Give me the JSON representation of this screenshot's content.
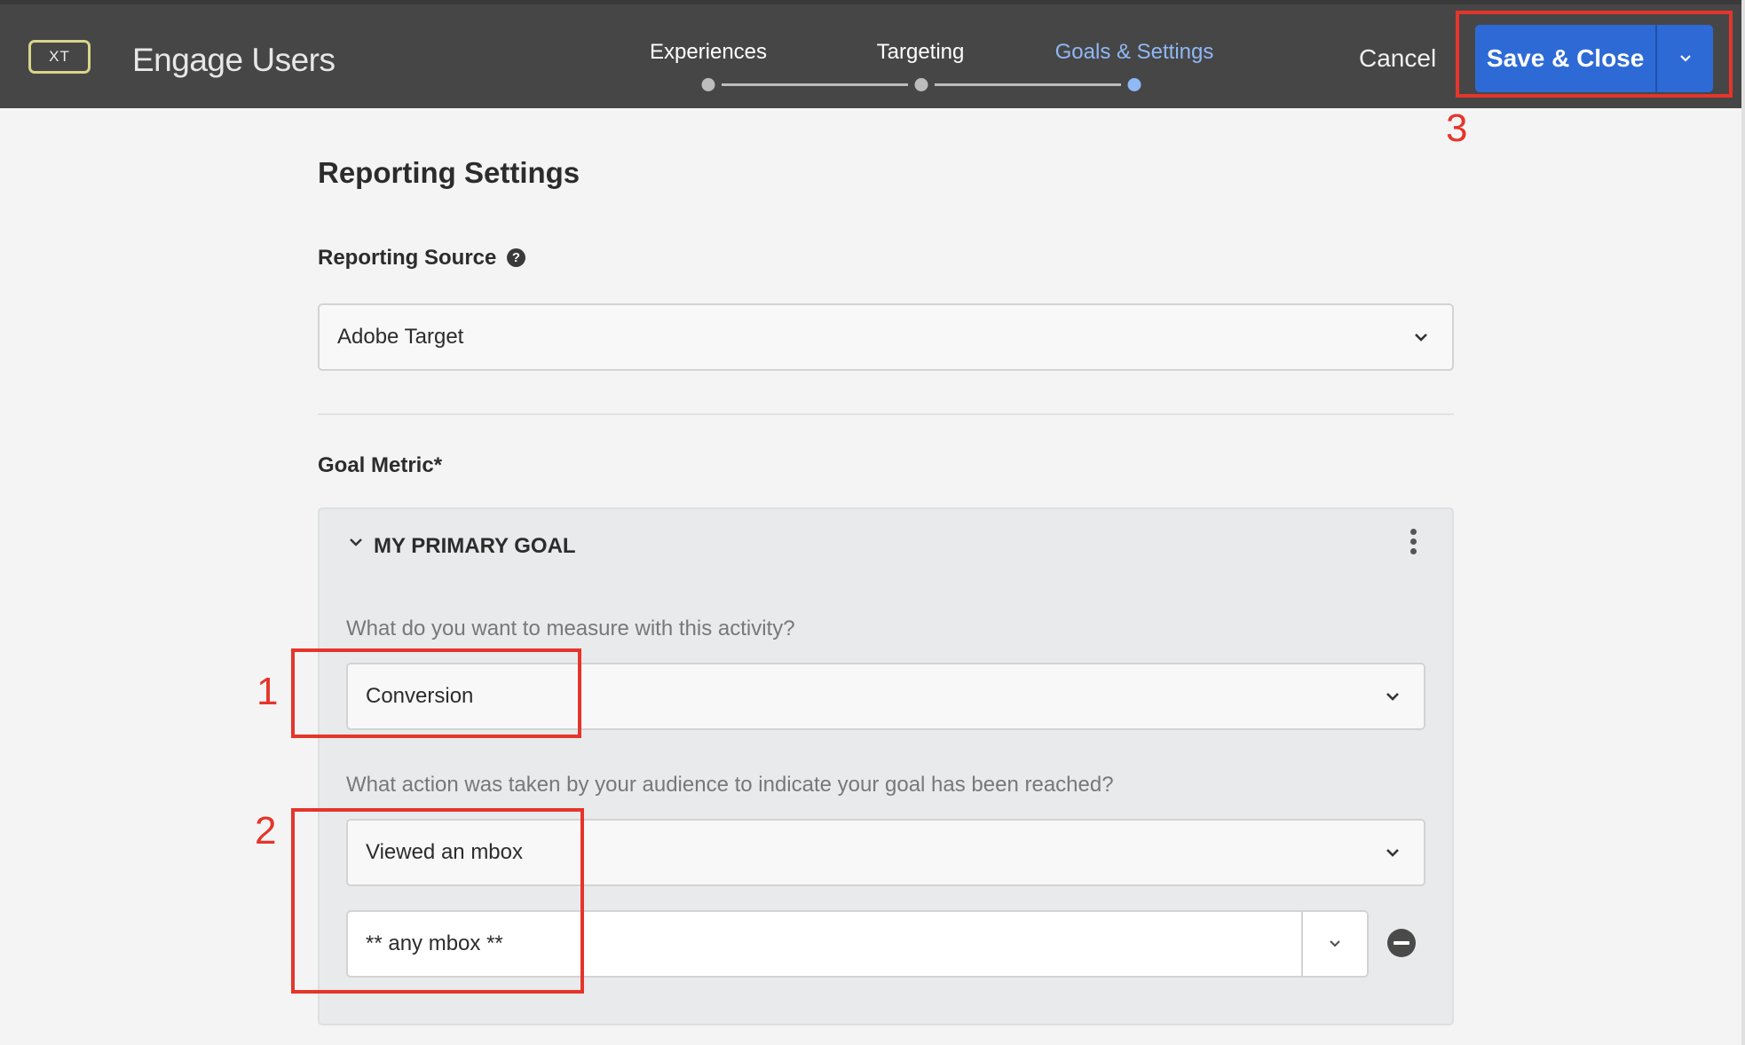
{
  "header": {
    "badge": "XT",
    "title": "Engage Users",
    "steps": [
      {
        "label": "Experiences",
        "active": false
      },
      {
        "label": "Targeting",
        "active": false
      },
      {
        "label": "Goals & Settings",
        "active": true
      }
    ],
    "cancel_label": "Cancel",
    "save_label": "Save & Close",
    "save_menu_icon": "chevron-down-icon"
  },
  "reporting": {
    "section_title": "Reporting Settings",
    "source_label": "Reporting Source",
    "help_icon": "help-icon",
    "help_glyph": "?",
    "source_value": "Adobe Target"
  },
  "goal": {
    "label": "Goal Metric*",
    "card_title": "MY PRIMARY GOAL",
    "measure_question": "What do you want to measure with this activity?",
    "measure_value": "Conversion",
    "action_question": "What action was taken by your audience to indicate your goal has been reached?",
    "action_value": "Viewed an mbox",
    "mbox_value": "** any mbox **"
  },
  "annotations": [
    "1",
    "2",
    "3"
  ],
  "colors": {
    "header_bg": "#464646",
    "accent_blue": "#2d6ad6",
    "active_step": "#8fb8f5",
    "annotation_red": "#e5352b"
  }
}
